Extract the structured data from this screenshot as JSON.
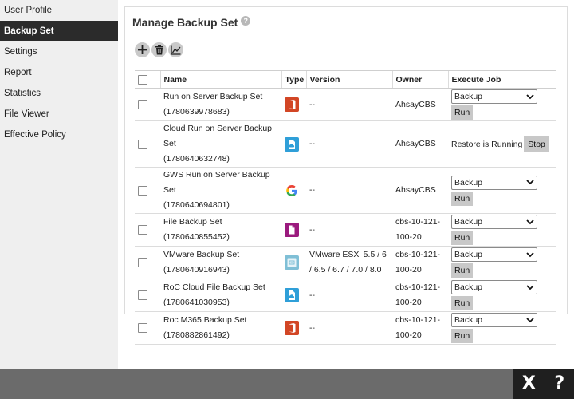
{
  "sidebar": {
    "items": [
      {
        "label": "User Profile",
        "active": false
      },
      {
        "label": "Backup Set",
        "active": true
      },
      {
        "label": "Settings",
        "active": false
      },
      {
        "label": "Report",
        "active": false
      },
      {
        "label": "Statistics",
        "active": false
      },
      {
        "label": "File Viewer",
        "active": false
      },
      {
        "label": "Effective Policy",
        "active": false
      }
    ]
  },
  "main": {
    "title": "Manage Backup Set",
    "help_icon": "?",
    "toolbar": [
      {
        "icon": "add-icon"
      },
      {
        "icon": "delete-icon"
      },
      {
        "icon": "chart-icon"
      }
    ],
    "table": {
      "headers": {
        "name": "Name",
        "type": "Type",
        "version": "Version",
        "owner": "Owner",
        "execute": "Execute Job"
      },
      "rows": [
        {
          "name": "Run on Server Backup Set",
          "id": "(1780639978683)",
          "type_icon": "office365-icon",
          "type_color": "#d24625",
          "version": "--",
          "owner": "AhsayCBS",
          "job": "Backup",
          "action": "Run"
        },
        {
          "name": "Cloud Run on Server Backup Set",
          "id": "(1780640632748)",
          "type_icon": "cloud-file-icon",
          "type_color": "#2f9fd8",
          "version": "--",
          "owner": "AhsayCBS",
          "status": "Restore is Running",
          "action": "Stop"
        },
        {
          "name": "GWS Run on Server Backup Set",
          "id": "(1780640694801)",
          "type_icon": "google-icon",
          "type_color": "#ffffff",
          "version": "--",
          "owner": "AhsayCBS",
          "job": "Backup",
          "action": "Run"
        },
        {
          "name": "File Backup Set",
          "id": "(1780640855452)",
          "type_icon": "file-icon",
          "type_color": "#9b1a7e",
          "version": "--",
          "owner": "cbs-10-121-100-20",
          "job": "Backup",
          "action": "Run"
        },
        {
          "name": "VMware Backup Set",
          "id": "(1780640916943)",
          "type_icon": "vmware-icon",
          "type_color": "#7fbfd6",
          "version": "VMware ESXi 5.5 / 6 / 6.5 / 6.7 / 7.0 / 8.0",
          "owner": "cbs-10-121-100-20",
          "job": "Backup",
          "action": "Run"
        },
        {
          "name": "RoC Cloud File Backup Set",
          "id": "(1780641030953)",
          "type_icon": "cloud-file-icon",
          "type_color": "#2f9fd8",
          "version": "--",
          "owner": "cbs-10-121-100-20",
          "job": "Backup",
          "action": "Run"
        },
        {
          "name": "Roc M365 Backup Set",
          "id": "(1780882861492)",
          "type_icon": "office365-icon",
          "type_color": "#d24625",
          "version": "--",
          "owner": "cbs-10-121-100-20",
          "job": "Backup",
          "action": "Run"
        }
      ]
    }
  },
  "bottom_bar": {
    "close": "X",
    "help": "?"
  }
}
